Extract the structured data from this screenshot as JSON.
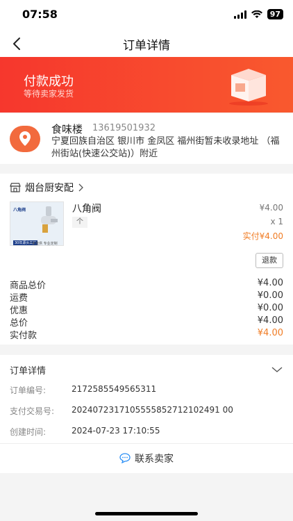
{
  "status_bar": {
    "time": "07:58",
    "battery": "97"
  },
  "nav": {
    "title": "订单详情",
    "back_icon": "chevron-left-icon"
  },
  "banner": {
    "title": "付款成功",
    "subtitle": "等待卖家发货",
    "background": "#f6372d"
  },
  "address": {
    "name": "食味楼",
    "phone": "13619501932",
    "line": "宁夏回族自治区 银川市 金凤区 福州街暂未收录地址 （福州街站(快速公交站)）附近",
    "icon": "location-pin-icon",
    "icon_color": "#f26a3d"
  },
  "shop": {
    "name": "烟台厨安配",
    "icon": "store-icon"
  },
  "product": {
    "name": "八角阀",
    "spec": "个",
    "price": "¥4.00",
    "qty": "x 1",
    "paid": "实付¥4.00",
    "thumb_text_title": "八角阀",
    "thumb_text_badge": "30年源头工厂",
    "thumb_text_tag": "厂家直供 专业定制"
  },
  "refund_label": "退款",
  "summary": [
    {
      "label": "商品总价",
      "value": "¥4.00"
    },
    {
      "label": "运费",
      "value": "¥0.00"
    },
    {
      "label": "优惠",
      "value": "¥0.00"
    },
    {
      "label": "总价",
      "value": "¥4.00"
    },
    {
      "label": "实付款",
      "value": "¥4.00"
    }
  ],
  "order_detail": {
    "header": "订单详情",
    "rows": [
      {
        "label": "订单编号:",
        "value": "2172585549565311"
      },
      {
        "label": "支付交易号:",
        "value": "2024072317105555852712102491 00"
      },
      {
        "label": "创建时间:",
        "value": "2024-07-23 17:10:55"
      }
    ],
    "contact_label": "联系卖家"
  },
  "accent_color": "#f07c24"
}
